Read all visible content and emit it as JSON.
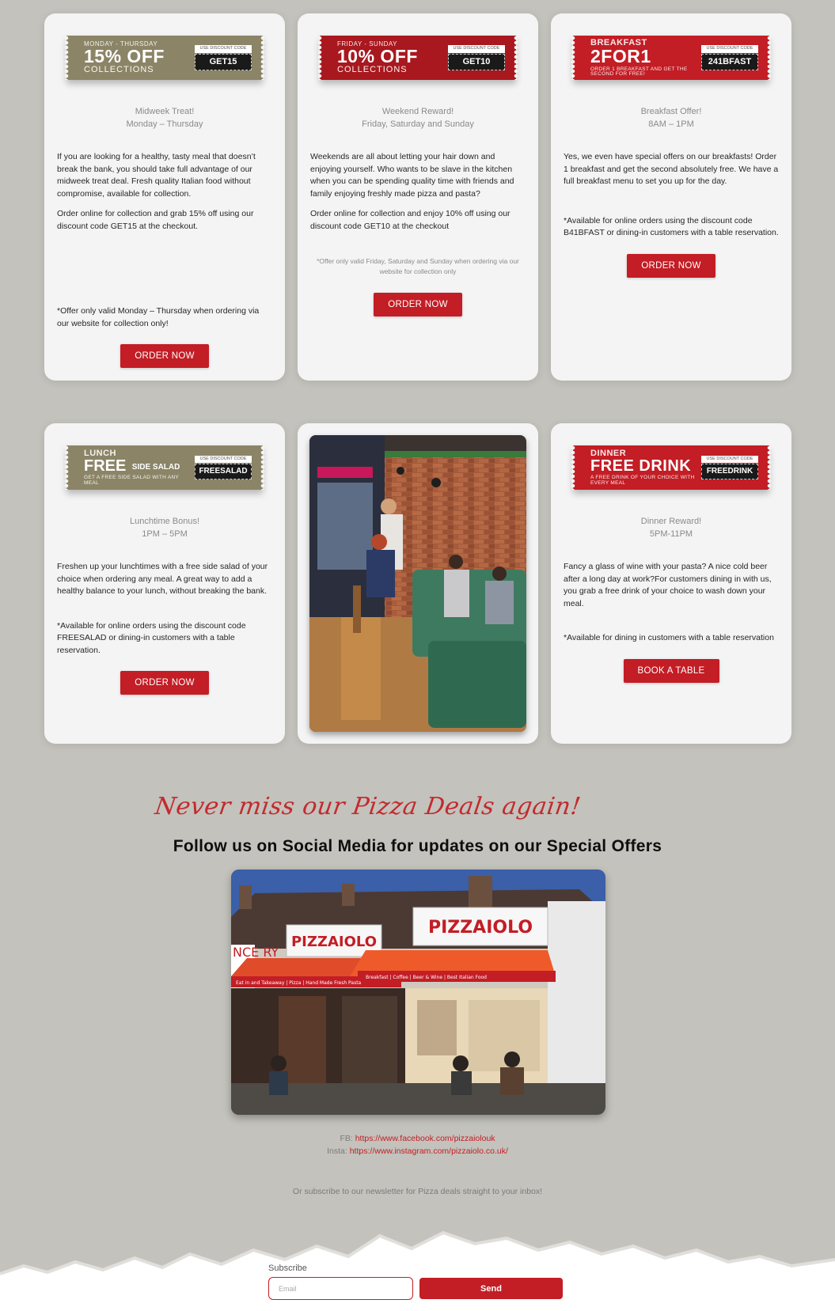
{
  "cards": [
    {
      "coupon": {
        "small": "MONDAY - THURSDAY",
        "big": "15% OFF",
        "sub": "COLLECTIONS",
        "code_label": "USE DISCOUNT CODE",
        "code": "GET15",
        "color": "#8b8466"
      },
      "title_line1": "Midweek Treat!",
      "title_line2": "Monday – Thursday",
      "body1": "If you are looking for a healthy, tasty meal that doesn’t break the bank, you should take full advantage of our midweek treat deal. Fresh quality Italian food without compromise, available for collection.",
      "body2": "Order online for collection and grab 15% off using our discount code GET15 at the checkout.",
      "note": "*Offer only valid Monday – Thursday when ordering via our website for collection only!",
      "button": "ORDER NOW"
    },
    {
      "coupon": {
        "small": "FRIDAY - SUNDAY",
        "big": "10% OFF",
        "sub": "COLLECTIONS",
        "code_label": "USE DISCOUNT CODE",
        "code": "GET10",
        "color": "#a8181e"
      },
      "title_line1": "Weekend Reward!",
      "title_line2": "Friday, Saturday and Sunday",
      "body1": "Weekends are all about letting your hair down and enjoying yourself. Who wants to be slave in the kitchen when you can be spending quality time with friends and family enjoying freshly made pizza and pasta?",
      "body2": "Order online for collection and enjoy 10% off using our discount code GET10 at the checkout",
      "note": "*Offer only valid Friday, Saturday and Sunday when ordering via our website for collection only",
      "button": "ORDER NOW"
    },
    {
      "coupon": {
        "small": "BREAKFAST",
        "big": "2FOR1",
        "sub": "ORDER 1 BREAKFAST AND GET THE SECOND FOR FREE!",
        "code_label": "USE DISCOUNT CODE",
        "code": "241BFAST",
        "color": "#c31d25"
      },
      "title_line1": "Breakfast Offer!",
      "title_line2": "8AM – 1PM",
      "body1": "Yes, we even have special offers on our breakfasts! Order 1 breakfast and get the second absolutely free. We have a full breakfast menu to set you up for the day.",
      "note": "*Available for online orders using the discount code B41BFAST or dining-in customers with a table reservation.",
      "button": "ORDER NOW"
    },
    {
      "coupon": {
        "small": "LUNCH",
        "big": "FREE",
        "side": "SIDE SALAD",
        "sub": "GET A FREE SIDE SALAD WITH ANY MEAL",
        "code_label": "USE DISCOUNT CODE",
        "code": "FREESALAD",
        "color": "#8b8466"
      },
      "title_line1": "Lunchtime Bonus!",
      "title_line2": "1PM – 5PM",
      "body1": "Freshen up your lunchtimes with a free side salad of your choice when ordering any meal. A great way to add a healthy balance to your lunch, without breaking the bank.",
      "note": "*Available for online orders using the discount code FREESALAD or dining-in customers with a table reservation.",
      "button": "ORDER NOW"
    },
    {
      "coupon": {
        "small": "DINNER",
        "big": "FREE DRINK",
        "sub": "A FREE DRINK OF YOUR CHOICE WITH EVERY MEAL",
        "code_label": "USE DISCOUNT CODE",
        "code": "FREEDRINK",
        "color": "#c31d25"
      },
      "title_line1": "Dinner Reward!",
      "title_line2": "5PM-11PM",
      "body1": "Fancy a glass of wine with your pasta? A nice cold beer after a long day at work?For customers dining in with us, you grab a free drink of your choice to wash down your meal.",
      "note": "*Available for dining in customers with a table reservation",
      "button": "BOOK A TABLE"
    }
  ],
  "social": {
    "script_heading": "Never miss our Pizza Deals again!",
    "heading": "Follow us on Social Media for updates on our Special Offers",
    "fb_label": "FB:",
    "fb_url": "https://www.facebook.com/pizzaiolouk",
    "insta_label": "Insta:",
    "insta_url": "https://www.instagram.com/pizzaiolo.co.uk/",
    "sign_left": "PIZZAIOLO",
    "sign_right": "PIZZAIOLO",
    "awning_left": "Eat in and Takeaway | Pizza | Hand Made Fresh Pasta",
    "awning_right": "Breakfast | Coffee | Beer & Wine | Best Italian Food",
    "side_sign": "NCE RY"
  },
  "newsletter": {
    "text": "Or subscribe to our newsletter for Pizza deals straight to your inbox!",
    "label": "Subscribe",
    "placeholder": "Email",
    "button": "Send"
  },
  "colors": {
    "accent": "#c31d25",
    "background": "#c3c2bc",
    "card": "#f4f4f4"
  }
}
